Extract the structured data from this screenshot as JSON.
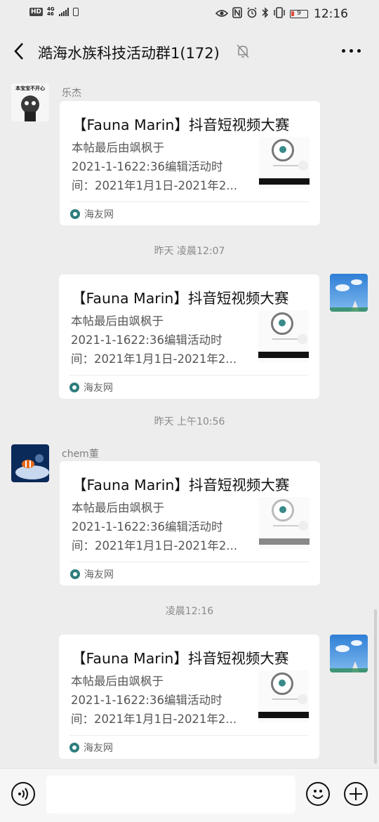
{
  "status_bar": {
    "hd": "HD",
    "net_top": "4G",
    "net_bottom": "46",
    "battery": "9",
    "time": "12:16"
  },
  "header": {
    "title": "澔海水族科技活动群1(172)"
  },
  "messages": [
    {
      "sender": "乐杰"
    },
    {
      "time": "昨天 凌晨12:07"
    },
    {
      "time": "昨天 上午10:56"
    },
    {
      "sender": "chem董"
    },
    {
      "time": "凌晨12:16"
    }
  ],
  "card": {
    "title": "【Fauna Marin】抖音短视频大赛",
    "desc_line1": "本帖最后由飒枫于",
    "desc_line2": "2021-1-1622:36编辑活动时",
    "desc_line3": "间：2021年1月1日-2021年2...",
    "source": "海友网"
  },
  "avatar1_text": "本宝宝不开心",
  "colors": {
    "background": "#ededed",
    "card": "#ffffff",
    "time_text": "#8a8a8a"
  }
}
